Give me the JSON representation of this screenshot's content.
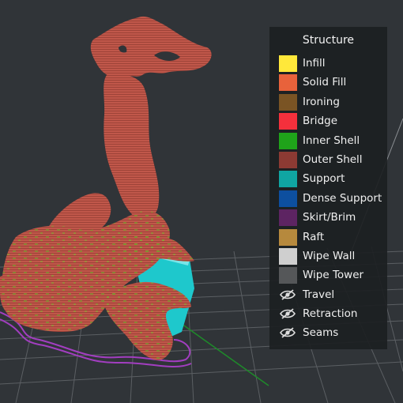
{
  "legend": {
    "title": "Structure",
    "items": [
      {
        "label": "Infill",
        "color": "#ffe83a",
        "kind": "swatch",
        "name": "legend-item-infill"
      },
      {
        "label": "Solid Fill",
        "color": "#e8623b",
        "kind": "swatch",
        "name": "legend-item-solid-fill"
      },
      {
        "label": "Ironing",
        "color": "#7a5424",
        "kind": "swatch",
        "name": "legend-item-ironing"
      },
      {
        "label": "Bridge",
        "color": "#f4303c",
        "kind": "swatch",
        "name": "legend-item-bridge"
      },
      {
        "label": "Inner Shell",
        "color": "#1fa31a",
        "kind": "swatch",
        "name": "legend-item-inner-shell"
      },
      {
        "label": "Outer Shell",
        "color": "#8c3a33",
        "kind": "swatch",
        "name": "legend-item-outer-shell"
      },
      {
        "label": "Support",
        "color": "#10a5a2",
        "kind": "swatch",
        "name": "legend-item-support"
      },
      {
        "label": "Dense Support",
        "color": "#0d4f9f",
        "kind": "swatch",
        "name": "legend-item-dense-support"
      },
      {
        "label": "Skirt/Brim",
        "color": "#5d2462",
        "kind": "swatch",
        "name": "legend-item-skirt-brim"
      },
      {
        "label": "Raft",
        "color": "#b6893d",
        "kind": "swatch",
        "name": "legend-item-raft"
      },
      {
        "label": "Wipe Wall",
        "color": "#cfcfcf",
        "kind": "swatch",
        "name": "legend-item-wipe-wall"
      },
      {
        "label": "Wipe Tower",
        "color": "#555759",
        "kind": "swatch",
        "name": "legend-item-wipe-tower"
      },
      {
        "label": "Travel",
        "kind": "hidden",
        "icon": "eye-slash-icon",
        "name": "legend-item-travel"
      },
      {
        "label": "Retraction",
        "kind": "hidden",
        "icon": "eye-slash-icon",
        "name": "legend-item-retraction"
      },
      {
        "label": "Seams",
        "kind": "hidden",
        "icon": "eye-slash-icon",
        "name": "legend-item-seams"
      }
    ]
  },
  "scene": {
    "model_color": "#c0574a",
    "model_highlight_color": "#7a9a2e",
    "support_color": "#1ec8cc",
    "skirt_color": "#a23ec0",
    "grid_color": "#5b5f63",
    "axis_color": "#1e8a2a"
  }
}
